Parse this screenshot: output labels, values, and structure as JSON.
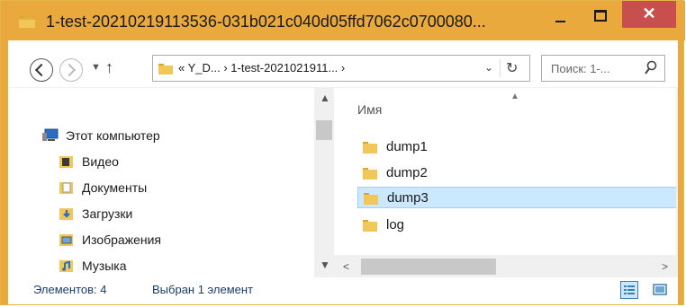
{
  "window": {
    "title": "1-test-20210219113536-031b021c040d05ffd7062c0700080...",
    "minimize_label": "–",
    "maximize_label": "□",
    "close_label": "✕"
  },
  "navbar": {
    "back_icon": "back-arrow-icon",
    "forward_icon": "forward-arrow-icon",
    "recent_icon": "chevron-down-icon",
    "up_glyph": "↑",
    "address": {
      "prefix": "«",
      "segments": [
        "Y_D...",
        "1-test-2021021911..."
      ],
      "separator": "›",
      "text": "«  Y_D...  ›  1-test-2021021911...  ›",
      "dropdown_glyph": "⌄",
      "refresh_glyph": "↻"
    },
    "search": {
      "placeholder": "Поиск: 1-...",
      "icon": "search-icon"
    }
  },
  "nav_pane": {
    "items": [
      {
        "label": "Этот компьютер",
        "icon": "computer-icon",
        "indent": 0
      },
      {
        "label": "Видео",
        "icon": "video-folder-icon",
        "indent": 1
      },
      {
        "label": "Документы",
        "icon": "documents-folder-icon",
        "indent": 1
      },
      {
        "label": "Загрузки",
        "icon": "downloads-folder-icon",
        "indent": 1
      },
      {
        "label": "Изображения",
        "icon": "pictures-folder-icon",
        "indent": 1
      },
      {
        "label": "Музыка",
        "icon": "music-folder-icon",
        "indent": 1
      }
    ],
    "scroll_up": "▲",
    "scroll_down": "▼"
  },
  "file_pane": {
    "column_header": "Имя",
    "sort_glyph": "^",
    "files": [
      {
        "name": "dump1",
        "selected": false
      },
      {
        "name": "dump2",
        "selected": false
      },
      {
        "name": "dump3",
        "selected": true
      },
      {
        "name": "log",
        "selected": false
      }
    ],
    "scroll_left": "<",
    "scroll_right": ">"
  },
  "statusbar": {
    "count": "Элементов: 4",
    "selection": "Выбран 1 элемент"
  },
  "colors": {
    "titlebar": "#e9a93c",
    "close": "#c7504f",
    "selection": "#cce8ff",
    "folder": "#e8b848"
  }
}
